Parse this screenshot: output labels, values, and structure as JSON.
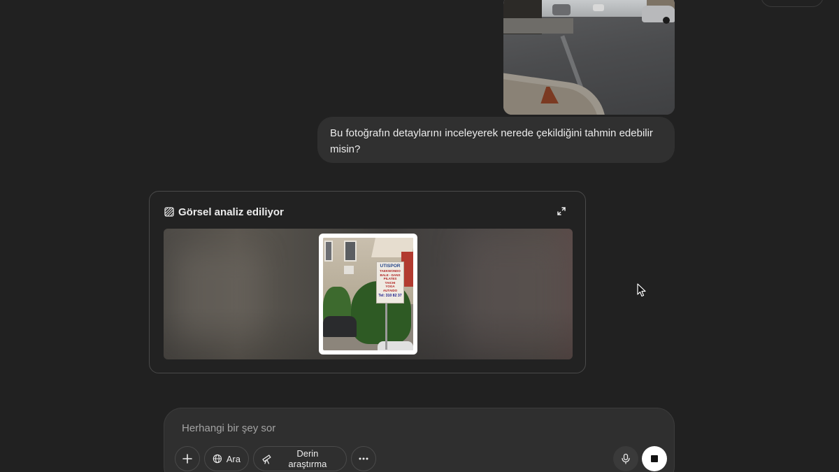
{
  "conversation": {
    "user_message": "Bu fotoğrafın detaylarını inceleyerek nerede çekildiğini tahmin edebilir misin?",
    "attachment": {
      "kind": "street-photo"
    }
  },
  "analysis": {
    "title": "Görsel analiz ediliyor",
    "title_icon": "image-analysis-icon",
    "expand_icon": "expand-icon",
    "thumbnail": {
      "sign_heading": "UTISPOR",
      "sign_lines": [
        "TAEKWONDO",
        "BALE - DANS",
        "PILATES",
        "TAICHI",
        "YOGA",
        "AUTAIDO"
      ],
      "sign_phone": "Tel: 310 82 37"
    }
  },
  "composer": {
    "placeholder": "Herhangi bir şey sor",
    "buttons": {
      "add_icon": "plus-icon",
      "search_label": "Ara",
      "search_icon": "globe-icon",
      "deep_research_label": "Derin araştırma",
      "deep_research_icon": "telescope-icon",
      "more_icon": "ellipsis-icon",
      "mic_icon": "microphone-icon",
      "stop_icon": "stop-icon"
    }
  },
  "colors": {
    "background": "#212121",
    "bubble": "#303030",
    "composer": "#2f2f2f",
    "border": "#4a4a4a",
    "text": "#ececec",
    "placeholder": "#a3a3a3"
  }
}
